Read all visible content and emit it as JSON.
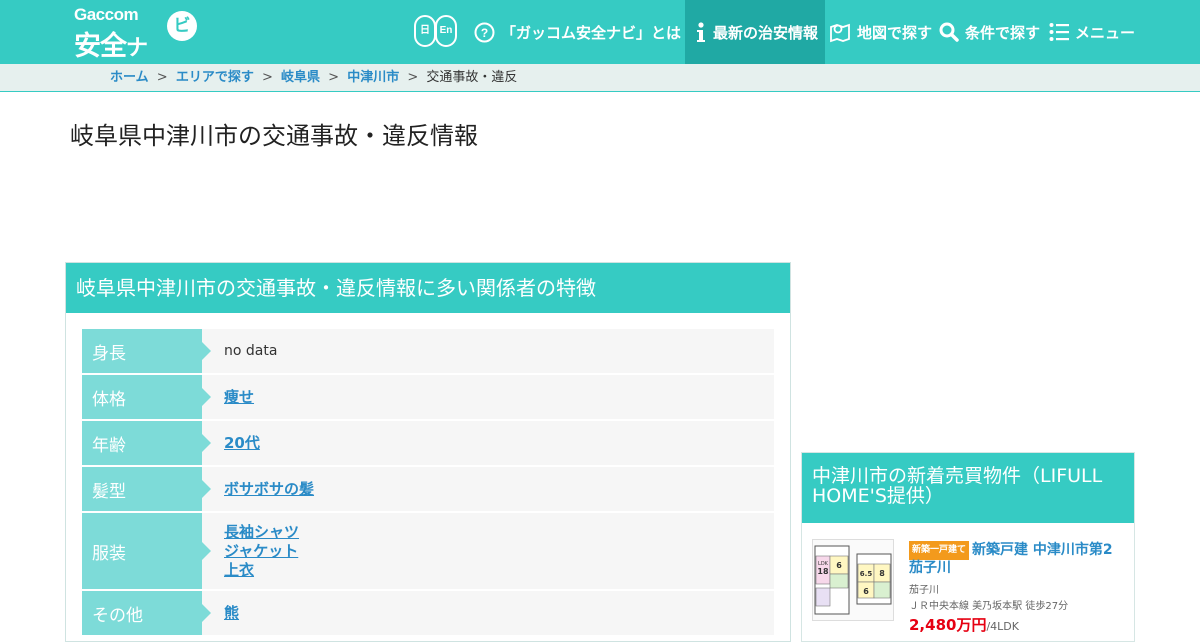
{
  "header": {
    "logo_small": "Gaccom",
    "logo_big": "安全",
    "logo_na": "ナ",
    "logo_bubble": "ビ",
    "lang_ja": "日",
    "lang_en": "En",
    "nav": {
      "about": "「ガッコム安全ナビ」とは",
      "news": "最新の治安情報",
      "map": "地図で探す",
      "search": "条件で探す",
      "menu": "メニュー"
    }
  },
  "breadcrumb": {
    "items": [
      "ホーム",
      "エリアで探す",
      "岐阜県",
      "中津川市"
    ],
    "current": "交通事故・違反",
    "separator": ">"
  },
  "page_title": "岐阜県中津川市の交通事故・違反情報",
  "features": {
    "heading": "岐阜県中津川市の交通事故・違反情報に多い関係者の特徴",
    "rows": [
      {
        "label": "身長",
        "values": [
          "no data"
        ],
        "linked": false
      },
      {
        "label": "体格",
        "values": [
          "痩せ"
        ],
        "linked": true
      },
      {
        "label": "年齢",
        "values": [
          "20代"
        ],
        "linked": true
      },
      {
        "label": "髪型",
        "values": [
          "ボサボサの髪"
        ],
        "linked": true
      },
      {
        "label": "服装",
        "values": [
          "長袖シャツ",
          "ジャケット",
          "上衣"
        ],
        "linked": true
      },
      {
        "label": "その他",
        "values": [
          "熊"
        ],
        "linked": true
      }
    ]
  },
  "sidebar": {
    "heading": "中津川市の新着売買物件（LIFULL HOME'S提供）",
    "property": {
      "tag": "新築一戸建て",
      "title": "新築戸建 中津川市第2茄子川",
      "area": "茄子川",
      "access": "ＪＲ中央本線 美乃坂本駅 徒歩27分",
      "price": "2,480万円",
      "layout": "/4LDK",
      "floorplan_labels": [
        "LDK",
        "18",
        "6",
        "6.5",
        "8",
        "6"
      ]
    }
  },
  "colors": {
    "brand": "#36cbc3",
    "nav_active": "#20a9a4",
    "label_bg": "#7ddbd8",
    "link": "#2a8bc7",
    "price": "#e60012",
    "tag": "#f39a1c"
  }
}
